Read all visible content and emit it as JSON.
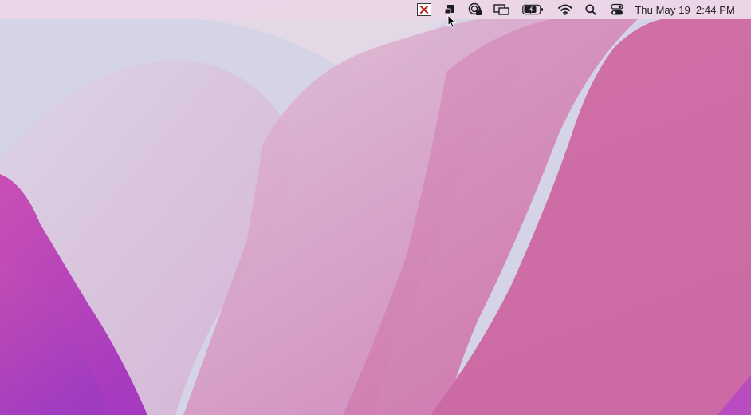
{
  "menubar": {
    "status_items": [
      {
        "icon": "close-app-icon",
        "accent": "#c0262b"
      },
      {
        "icon": "display-mirror-icon"
      },
      {
        "icon": "vpn-lock-icon"
      },
      {
        "icon": "screen-sharing-icon"
      },
      {
        "icon": "battery-charging-icon"
      },
      {
        "icon": "wifi-icon"
      },
      {
        "icon": "spotlight-search-icon"
      },
      {
        "icon": "control-center-icon"
      }
    ],
    "clock": {
      "day_date": "Thu May 19",
      "time": "2:44 PM"
    }
  },
  "colors": {
    "menubar_bg": "#ecd6e8",
    "wallpaper_light": "#d6d4e6",
    "wallpaper_pink": "#cf72a8",
    "wallpaper_magenta": "#b13ab4"
  }
}
